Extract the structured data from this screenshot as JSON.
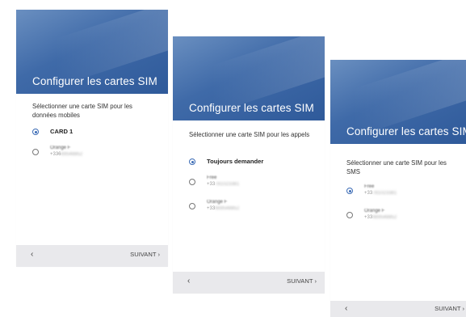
{
  "screens": [
    {
      "banner_title": "Configurer les cartes SIM",
      "prompt": "Sélectionner une carte SIM pour les données mobiles",
      "options": [
        {
          "label": "CARD 1",
          "selected": true
        },
        {
          "name": "Orange F",
          "number_prefix": "+336",
          "number_hidden": "69548852",
          "selected": false
        }
      ],
      "back_label": "‹",
      "next_label": "SUIVANT ›"
    },
    {
      "banner_title": "Configurer les cartes SIM",
      "prompt": "Sélectionner une carte SIM pour les appels",
      "options": [
        {
          "label": "Toujours demander",
          "selected": true
        },
        {
          "name": "Free",
          "number_prefix": "+33",
          "number_hidden": "781023381",
          "selected": false
        },
        {
          "name": "Orange F",
          "number_prefix": "+33",
          "number_hidden": "669548852",
          "selected": false
        }
      ],
      "back_label": "‹",
      "next_label": "SUIVANT ›"
    },
    {
      "banner_title": "Configurer les cartes SIM",
      "prompt": "Sélectionner une carte SIM pour les SMS",
      "options": [
        {
          "name": "Free",
          "number_prefix": "+33",
          "number_hidden": "781023381",
          "selected": true
        },
        {
          "name": "Orange F",
          "number_prefix": "+33",
          "number_hidden": "669548852",
          "selected": false
        }
      ],
      "back_label": "‹",
      "next_label": "SUIVANT ›"
    }
  ],
  "colors": {
    "banner": "#3f6aa8",
    "radio_selected": "#3b6bb5",
    "footer": "#e9e9ec"
  }
}
